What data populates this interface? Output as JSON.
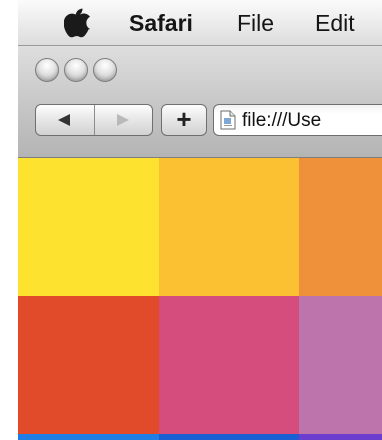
{
  "menubar": {
    "app_name": "Safari",
    "items": [
      "File",
      "Edit"
    ],
    "apple_icon": "apple-logo-icon"
  },
  "window": {
    "traffic_lights": [
      "close",
      "minimize",
      "zoom"
    ],
    "nav": {
      "back_icon": "back-arrow-icon",
      "forward_icon": "forward-arrow-icon"
    },
    "add_button_label": "+",
    "address": {
      "icon": "file-document-icon",
      "url": "file:///Use"
    }
  },
  "content": {
    "rows": [
      [
        "#fde230",
        "#fbc133",
        "#ef913a"
      ],
      [
        "#e14b2a",
        "#d44d7d",
        "#bd73ab"
      ],
      [
        "#1e7ee6",
        "#1b5fd4",
        "#6c3ed0"
      ]
    ]
  }
}
